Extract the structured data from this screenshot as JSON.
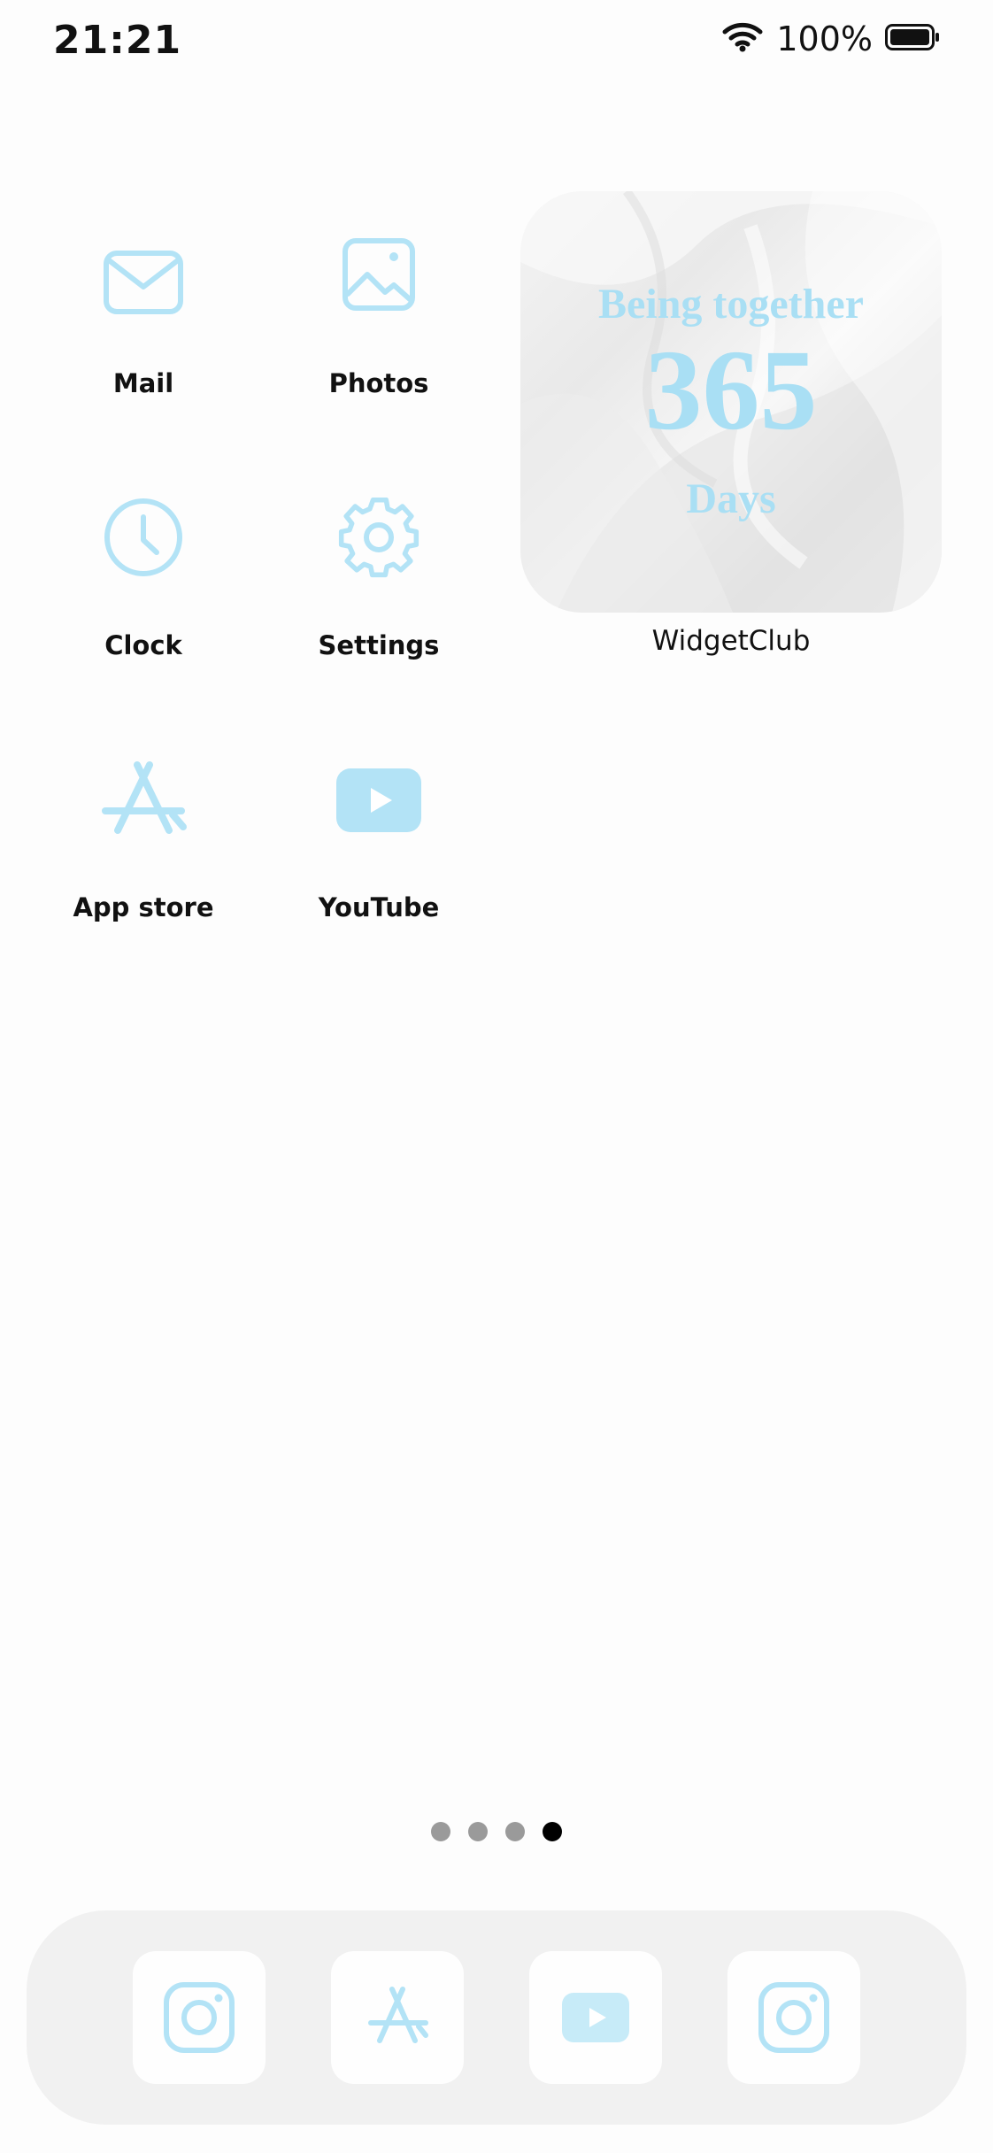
{
  "status_bar": {
    "time": "21:21",
    "battery_percent": "100%",
    "wifi_icon": "wifi-icon",
    "battery_icon": "battery-icon"
  },
  "apps": [
    {
      "label": "Mail",
      "icon": "mail-icon"
    },
    {
      "label": "Photos",
      "icon": "photos-icon"
    },
    {
      "label": "Clock",
      "icon": "clock-icon"
    },
    {
      "label": "Settings",
      "icon": "gear-icon"
    },
    {
      "label": "App store",
      "icon": "app-store-icon"
    },
    {
      "label": "YouTube",
      "icon": "youtube-icon"
    }
  ],
  "widget": {
    "line1": "Being together",
    "number": "365",
    "line3": "Days",
    "label": "WidgetClub",
    "text_color": "#a9dff4"
  },
  "page_indicator": {
    "total_pages": 4,
    "active_page": 4
  },
  "dock": {
    "items": [
      {
        "icon": "instagram-icon"
      },
      {
        "icon": "app-store-icon"
      },
      {
        "icon": "youtube-icon"
      },
      {
        "icon": "instagram-icon"
      }
    ]
  },
  "colors": {
    "icon_accent": "#b3e3f6",
    "background": "#fdfdfd",
    "dock_background": "#f1f1f1"
  }
}
